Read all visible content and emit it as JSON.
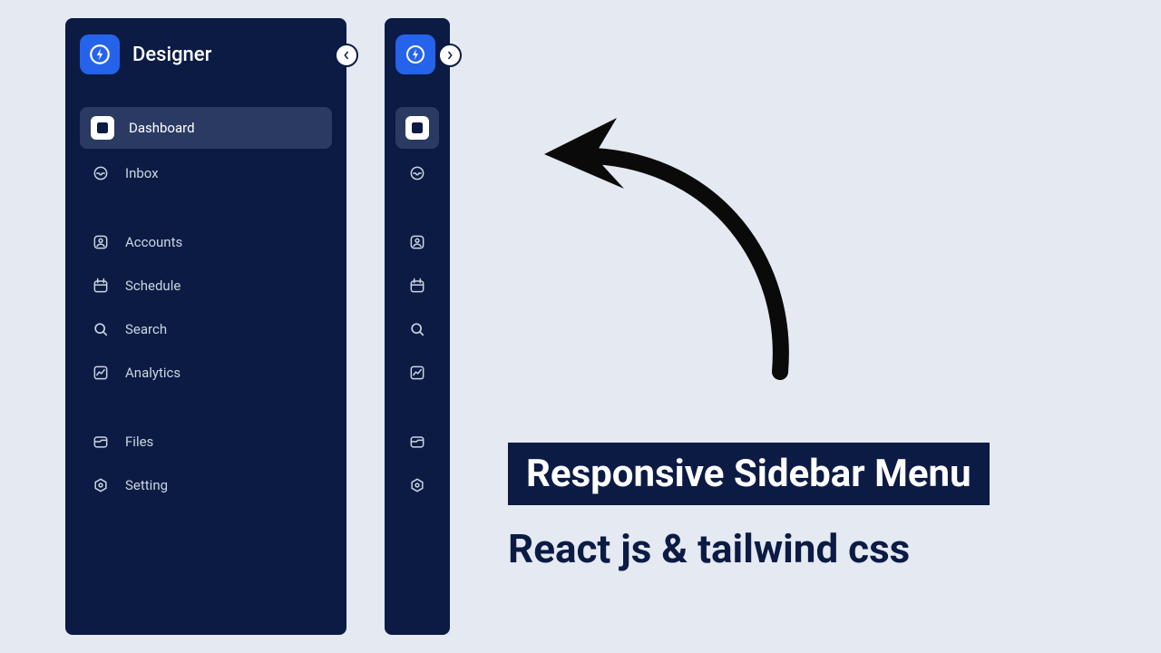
{
  "brand": {
    "name": "Designer"
  },
  "menu": {
    "group1": [
      {
        "icon": "bar-chart-icon",
        "label": "Dashboard",
        "active": true
      },
      {
        "icon": "inbox-icon",
        "label": "Inbox",
        "active": false
      }
    ],
    "group2": [
      {
        "icon": "user-icon",
        "label": "Accounts"
      },
      {
        "icon": "calendar-icon",
        "label": "Schedule"
      },
      {
        "icon": "search-icon",
        "label": "Search"
      },
      {
        "icon": "analytics-icon",
        "label": "Analytics"
      }
    ],
    "group3": [
      {
        "icon": "folder-icon",
        "label": "Files"
      },
      {
        "icon": "settings-icon",
        "label": "Setting"
      }
    ]
  },
  "headline": {
    "title": "Responsive Sidebar Menu",
    "subtitle": "React js & tailwind css"
  },
  "colors": {
    "bg": "#e4e9f2",
    "panel": "#0b1b44",
    "accent": "#2563eb",
    "itemActive": "#2a3a63"
  }
}
